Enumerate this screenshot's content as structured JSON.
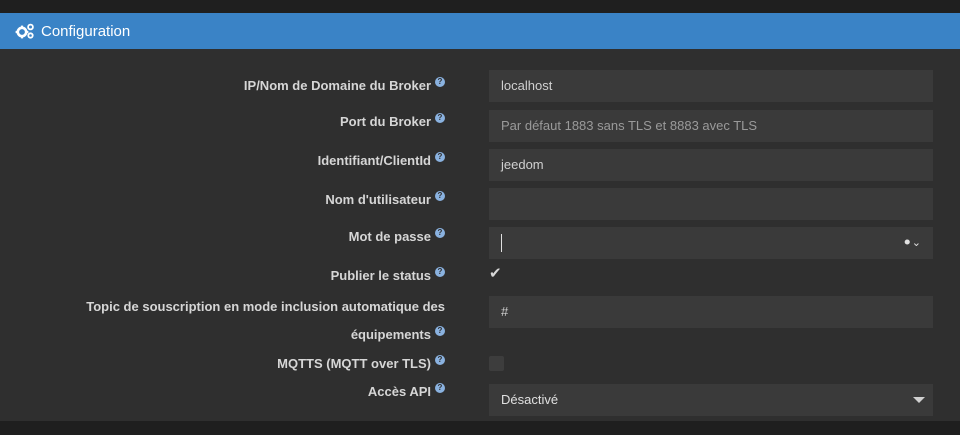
{
  "panel": {
    "title": "Configuration",
    "icon": "gears-icon"
  },
  "fields": {
    "broker_host": {
      "label": "IP/Nom de Domaine du Broker",
      "value": "localhost"
    },
    "broker_port": {
      "label": "Port du Broker",
      "placeholder": "Par défaut 1883 sans TLS et 8883 avec TLS"
    },
    "client_id": {
      "label": "Identifiant/ClientId",
      "value": "jeedom"
    },
    "username": {
      "label": "Nom d'utilisateur",
      "value": ""
    },
    "password": {
      "label": "Mot de passe",
      "value": ""
    },
    "publish_status": {
      "label": "Publier le status",
      "checked": true
    },
    "subscription_topic": {
      "label": "Topic de souscription en mode inclusion automatique des équipements",
      "value": "#"
    },
    "mqtts": {
      "label": "MQTTS (MQTT over TLS)",
      "checked": false
    },
    "api_access": {
      "label": "Accès API",
      "value": "Désactivé"
    }
  },
  "help_glyph": "?",
  "colors": {
    "accent": "#3a83c6",
    "panel_bg": "#2f2f2f",
    "input_bg": "#3a3a3a",
    "help": "#8ab2e0"
  }
}
